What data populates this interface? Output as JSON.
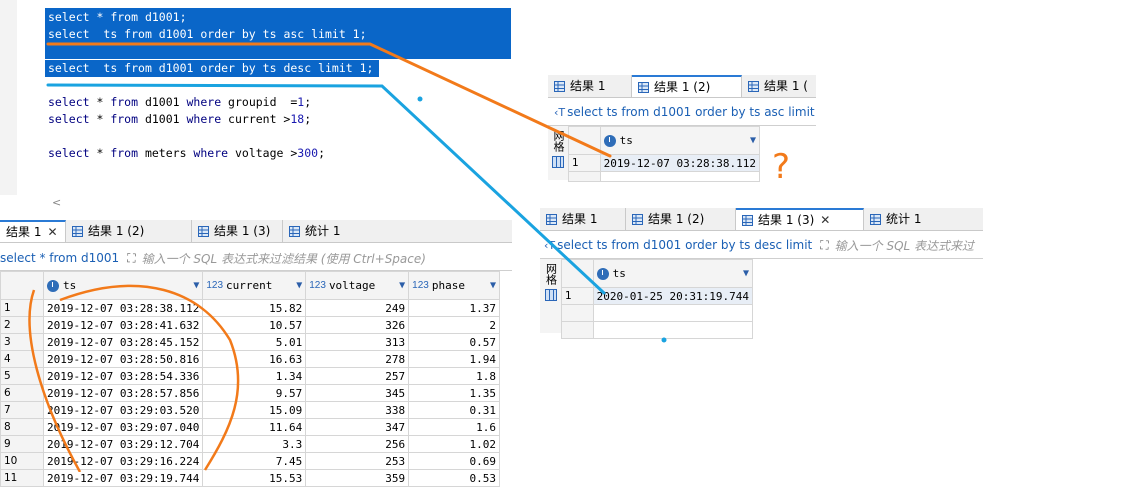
{
  "editor": {
    "lines": [
      {
        "kw1": "select",
        "t1": " * ",
        "kw2": "from",
        "t2": " d1001;",
        "kw3": "",
        "t3": "",
        "kw4": "",
        "t4": "",
        "kw5": "",
        "t5": "",
        "selected": true
      },
      {
        "kw1": "select",
        "t1": "  ts ",
        "kw2": "from",
        "t2": " d1001 ",
        "kw3": "order by",
        "t3": " ts ",
        "kw4": "asc limit",
        "t4": " 1;",
        "kw5": "",
        "t5": "",
        "selected": true
      },
      {
        "kw1": "select",
        "t1": "  ts ",
        "kw2": "from",
        "t2": " d1001 ",
        "kw3": "order by",
        "t3": " ts ",
        "kw4": "desc limit",
        "t4": " 1;",
        "kw5": "",
        "t5": "",
        "selected": true
      },
      {
        "kw1": "select",
        "t1": " * ",
        "kw2": "from",
        "t2": " d1001 ",
        "kw3": "where",
        "t3": " groupid  =",
        "num": "1",
        "t4": ";",
        "selected": false
      },
      {
        "kw1": "select",
        "t1": " * ",
        "kw2": "from",
        "t2": " d1001 ",
        "kw3": "where",
        "t3": " current >",
        "num": "18",
        "t4": ";",
        "selected": false
      },
      {
        "kw1": "select",
        "t1": " * ",
        "kw2": "from",
        "t2": " meters ",
        "kw3": "where",
        "t3": " voltage >",
        "num": "300",
        "t4": ";",
        "selected": false
      }
    ],
    "scroll_chevron": "<"
  },
  "main_panel": {
    "tabs": [
      {
        "label": "结果 1",
        "close": "✕"
      },
      {
        "label": "结果 1 (2)"
      },
      {
        "label": "结果 1 (3)"
      },
      {
        "label": "统计 1"
      }
    ],
    "query": "select * from d1001",
    "filter_placeholder": "输入一个 SQL 表达式来过滤结果 (使用 Ctrl+Space)",
    "columns": [
      {
        "type": "",
        "name": "ts"
      },
      {
        "type": "123",
        "name": "current"
      },
      {
        "type": "123",
        "name": "voltage"
      },
      {
        "type": "123",
        "name": "phase"
      }
    ],
    "rows": [
      {
        "n": "1",
        "ts": "2019-12-07 03:28:38.112",
        "current": "15.82",
        "voltage": "249",
        "phase": "1.37"
      },
      {
        "n": "2",
        "ts": "2019-12-07 03:28:41.632",
        "current": "10.57",
        "voltage": "326",
        "phase": "2"
      },
      {
        "n": "3",
        "ts": "2019-12-07 03:28:45.152",
        "current": "5.01",
        "voltage": "313",
        "phase": "0.57"
      },
      {
        "n": "4",
        "ts": "2019-12-07 03:28:50.816",
        "current": "16.63",
        "voltage": "278",
        "phase": "1.94"
      },
      {
        "n": "5",
        "ts": "2019-12-07 03:28:54.336",
        "current": "1.34",
        "voltage": "257",
        "phase": "1.8"
      },
      {
        "n": "6",
        "ts": "2019-12-07 03:28:57.856",
        "current": "9.57",
        "voltage": "345",
        "phase": "1.35"
      },
      {
        "n": "7",
        "ts": "2019-12-07 03:29:03.520",
        "current": "15.09",
        "voltage": "338",
        "phase": "0.31"
      },
      {
        "n": "8",
        "ts": "2019-12-07 03:29:07.040",
        "current": "11.64",
        "voltage": "347",
        "phase": "1.6"
      },
      {
        "n": "9",
        "ts": "2019-12-07 03:29:12.704",
        "current": "3.3",
        "voltage": "256",
        "phase": "1.02"
      },
      {
        "n": "10",
        "ts": "2019-12-07 03:29:16.224",
        "current": "7.45",
        "voltage": "253",
        "phase": "0.69"
      },
      {
        "n": "11",
        "ts": "2019-12-07 03:29:19.744",
        "current": "15.53",
        "voltage": "359",
        "phase": "0.53"
      }
    ]
  },
  "panel_asc": {
    "tabs": [
      {
        "label": "结果 1"
      },
      {
        "label": "结果 1 (2)"
      },
      {
        "label": "结果 1 ("
      }
    ],
    "query": "select ts from d1001 order by ts asc limit",
    "column": "ts",
    "side_label": "网格",
    "row": {
      "n": "1",
      "ts": "2019-12-07 03:28:38.112"
    },
    "annotation": "?"
  },
  "panel_desc": {
    "tabs": [
      {
        "label": "结果 1"
      },
      {
        "label": "结果 1 (2)"
      },
      {
        "label": "结果 1 (3)",
        "close": "✕"
      },
      {
        "label": "统计 1"
      }
    ],
    "query": "select ts from d1001 order by ts desc limit",
    "filter_placeholder": "输入一个 SQL 表达式来过",
    "column": "ts",
    "side_label": "网格",
    "row": {
      "n": "1",
      "ts": "2020-01-25 20:31:19.744"
    }
  },
  "colors": {
    "selection": "#0a66c8",
    "orange_annotation": "#f27a1a",
    "blue_annotation": "#1aa3e0"
  }
}
